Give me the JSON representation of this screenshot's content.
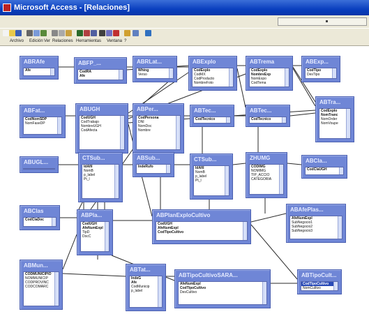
{
  "window": {
    "title": "Microsoft Access - [Relaciones]"
  },
  "menu": [
    "Archivo",
    "Edición",
    "Ver",
    "Relaciones",
    "Herramientas",
    "Ventana",
    "?"
  ],
  "toolbar_icons": [
    "new-icon",
    "open-icon",
    "save-icon",
    "print-icon",
    "preview-icon",
    "spell-icon",
    "cut-icon",
    "copy-icon",
    "paste-icon",
    "undo-icon",
    "show-table-icon",
    "show-direct-icon",
    "show-all-icon",
    "clear-layout-icon",
    "delete-icon",
    "database-window-icon",
    "new-object-icon",
    "help-icon"
  ],
  "tables": [
    {
      "name": "ABRAfe",
      "fields": [
        {
          "n": "Afe",
          "k": true
        }
      ]
    },
    {
      "name": "ABFP_...",
      "fields": [
        {
          "n": "CodRA",
          "k": true
        },
        {
          "n": "Afe",
          "k": true
        }
      ]
    },
    {
      "name": "ABRLat...",
      "fields": [
        {
          "n": "Whing",
          "k": true
        },
        {
          "n": "Verso",
          "k": false
        }
      ]
    },
    {
      "name": "ABExplo",
      "fields": [
        {
          "n": "CodExplo",
          "k": true
        },
        {
          "n": "CodMX",
          "k": false
        },
        {
          "n": "CodProducto",
          "k": false
        },
        {
          "n": "NombreFoto",
          "k": false
        }
      ]
    },
    {
      "name": "ABTrema",
      "fields": [
        {
          "n": "CodExplo",
          "k": true
        },
        {
          "n": "NombreExp",
          "k": true
        },
        {
          "n": "NomExpo",
          "k": false
        },
        {
          "n": "CodTema",
          "k": false
        }
      ]
    },
    {
      "name": "ABExp...",
      "fields": [
        {
          "n": "CodTipo",
          "k": true
        },
        {
          "n": "DesTipo",
          "k": false
        }
      ]
    },
    {
      "name": "ABTra...",
      "fields": [
        {
          "n": "CodExplo",
          "k": true
        },
        {
          "n": "NomTranc",
          "k": true
        },
        {
          "n": "NomOrder",
          "k": false
        },
        {
          "n": "NomVoupe",
          "k": false
        }
      ]
    },
    {
      "name": "ABFat...",
      "fields": [
        {
          "n": "CodNomSDP",
          "k": true
        },
        {
          "n": "NomFaseDP",
          "k": false
        }
      ]
    },
    {
      "name": "ABUGH",
      "fields": [
        {
          "n": "CodUGH",
          "k": true
        },
        {
          "n": "CodTrabajo",
          "k": false
        },
        {
          "n": "NombreUGH",
          "k": false
        },
        {
          "n": "CodAfecta",
          "k": false
        }
      ]
    },
    {
      "name": "ABPer...",
      "fields": [
        {
          "n": "CodPersona",
          "k": true
        },
        {
          "n": "DNI",
          "k": false
        },
        {
          "n": "NomDoc",
          "k": false
        },
        {
          "n": "Nombre",
          "k": false
        }
      ]
    },
    {
      "name": "ABTec...",
      "fields": [
        {
          "n": "CodTecnico",
          "k": true
        }
      ]
    },
    {
      "name": "ABTec...",
      "fields": [
        {
          "n": "CodTecnico",
          "k": true
        }
      ]
    },
    {
      "name": "ABCla...",
      "fields": [
        {
          "n": "CodClaUGH",
          "k": true
        }
      ]
    },
    {
      "name": "ABUGL...",
      "fields": []
    },
    {
      "name": "CTSub...",
      "fields": [
        {
          "n": "IdAfil",
          "k": true
        },
        {
          "n": "NomB",
          "k": false
        },
        {
          "n": "p_label",
          "k": false
        },
        {
          "n": "Pt_l",
          "k": false
        }
      ]
    },
    {
      "name": "ABSub...",
      "fields": [
        {
          "n": "IndeRufo",
          "k": true
        }
      ]
    },
    {
      "name": "CTSub...",
      "fields": [
        {
          "n": "IdAfil",
          "k": true
        },
        {
          "n": "NomB",
          "k": false
        },
        {
          "n": "p_label",
          "k": false
        },
        {
          "n": "Pt_l",
          "k": false
        }
      ]
    },
    {
      "name": "ZHUMG",
      "fields": [
        {
          "n": "CODIMG",
          "k": true
        },
        {
          "n": "NOMIMG",
          "k": false
        },
        {
          "n": "TIP_ACCIO",
          "k": false
        },
        {
          "n": "CATEGORIA",
          "k": false
        }
      ]
    },
    {
      "name": "ABClas",
      "fields": [
        {
          "n": "CodClaDoc",
          "k": true
        }
      ]
    },
    {
      "name": "ABPla...",
      "fields": [
        {
          "n": "CodUGH",
          "k": true
        },
        {
          "n": "AfeNumExpl",
          "k": true
        },
        {
          "n": "TipD",
          "k": false
        },
        {
          "n": "DocC",
          "k": false
        }
      ]
    },
    {
      "name": "ABPlanExploCultivo",
      "fields": [
        {
          "n": "CodUGH",
          "k": true
        },
        {
          "n": "AfeNumExpl",
          "k": true
        },
        {
          "n": "CodTipoCultivo",
          "k": true
        }
      ]
    },
    {
      "name": "ABAfePlas...",
      "fields": [
        {
          "n": "AfeNumExpl",
          "k": true
        },
        {
          "n": "SubNegocio1",
          "k": false
        },
        {
          "n": "SubNegocio2",
          "k": false
        },
        {
          "n": "SubNegocio3",
          "k": false
        }
      ]
    },
    {
      "name": "ABMun...",
      "fields": [
        {
          "n": "CODMUNICIPIO",
          "k": true
        },
        {
          "n": "NOMMUNICIP",
          "k": false
        },
        {
          "n": "CODPROVINC",
          "k": false
        },
        {
          "n": "CODCOMARC",
          "k": false
        }
      ]
    },
    {
      "name": "ABTat...",
      "fields": [
        {
          "n": "IndeG",
          "k": true
        },
        {
          "n": "Afe",
          "k": true
        },
        {
          "n": "CodMunicip",
          "k": false
        },
        {
          "n": "p_label",
          "k": false
        }
      ]
    },
    {
      "name": "ABTipoCultivoSARA...",
      "fields": [
        {
          "n": "AfeNumExpl",
          "k": true
        },
        {
          "n": "CodTipoCultivo",
          "k": true
        },
        {
          "n": "DesCultivo",
          "k": false
        }
      ]
    },
    {
      "name": "ABTipoCult...",
      "fields": [
        {
          "n": "CodTipoCultivo",
          "k": true,
          "sel": true
        },
        {
          "n": "NomCultivo",
          "k": false
        }
      ]
    }
  ]
}
